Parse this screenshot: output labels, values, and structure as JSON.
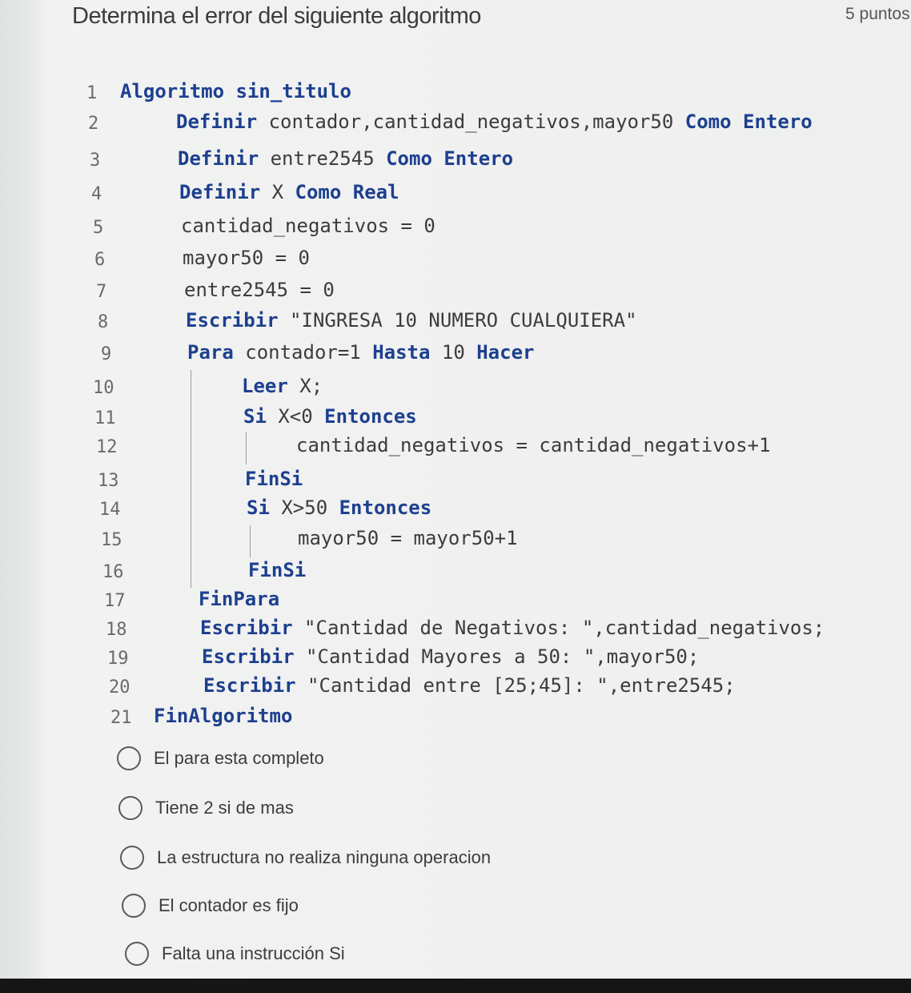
{
  "question": {
    "title": "Determina el error del siguiente algoritmo",
    "points": "5 puntos"
  },
  "code": [
    {
      "n": "1",
      "segs": [
        {
          "t": "Algoritmo",
          "kw": true
        },
        {
          "t": " sin_titulo",
          "kw": true
        }
      ]
    },
    {
      "n": "2",
      "segs": [
        {
          "t": "Definir",
          "kw": true
        },
        {
          "t": " contador,cantidad_negativos,mayor50 ",
          "kw": false
        },
        {
          "t": "Como Entero",
          "kw": true
        }
      ]
    },
    {
      "n": "3",
      "segs": [
        {
          "t": "Definir",
          "kw": true
        },
        {
          "t": " entre2545 ",
          "kw": false
        },
        {
          "t": "Como Entero",
          "kw": true
        }
      ]
    },
    {
      "n": "4",
      "segs": [
        {
          "t": "Definir",
          "kw": true
        },
        {
          "t": " X ",
          "kw": false
        },
        {
          "t": "Como Real",
          "kw": true
        }
      ]
    },
    {
      "n": "5",
      "segs": [
        {
          "t": "cantidad_negativos = 0",
          "kw": false
        }
      ]
    },
    {
      "n": "6",
      "segs": [
        {
          "t": "mayor50 = 0",
          "kw": false
        }
      ]
    },
    {
      "n": "7",
      "segs": [
        {
          "t": "entre2545 = 0",
          "kw": false
        }
      ]
    },
    {
      "n": "8",
      "segs": [
        {
          "t": "Escribir",
          "kw": true
        },
        {
          "t": " \"INGRESA 10 NUMERO CUALQUIERA\"",
          "kw": false
        }
      ]
    },
    {
      "n": "9",
      "segs": [
        {
          "t": "Para",
          "kw": true
        },
        {
          "t": " contador=1 ",
          "kw": false
        },
        {
          "t": "Hasta",
          "kw": true
        },
        {
          "t": " 10 ",
          "kw": false
        },
        {
          "t": "Hacer",
          "kw": true
        }
      ]
    },
    {
      "n": "10",
      "segs": [
        {
          "t": "Leer",
          "kw": true
        },
        {
          "t": " X;",
          "kw": false
        }
      ]
    },
    {
      "n": "11",
      "segs": [
        {
          "t": "Si",
          "kw": true
        },
        {
          "t": " X<0 ",
          "kw": false
        },
        {
          "t": "Entonces",
          "kw": true
        }
      ]
    },
    {
      "n": "12",
      "segs": [
        {
          "t": "cantidad_negativos = cantidad_negativos+1",
          "kw": false
        }
      ]
    },
    {
      "n": "13",
      "segs": [
        {
          "t": "FinSi",
          "kw": true
        }
      ]
    },
    {
      "n": "14",
      "segs": [
        {
          "t": "Si",
          "kw": true
        },
        {
          "t": " X>50 ",
          "kw": false
        },
        {
          "t": "Entonces",
          "kw": true
        }
      ]
    },
    {
      "n": "15",
      "segs": [
        {
          "t": "mayor50 = mayor50+1",
          "kw": false
        }
      ]
    },
    {
      "n": "16",
      "segs": [
        {
          "t": "FinSi",
          "kw": true
        }
      ]
    },
    {
      "n": "17",
      "segs": [
        {
          "t": "FinPara",
          "kw": true
        }
      ]
    },
    {
      "n": "18",
      "segs": [
        {
          "t": "Escribir",
          "kw": true
        },
        {
          "t": " \"Cantidad de Negativos: \",cantidad_negativos;",
          "kw": false
        }
      ]
    },
    {
      "n": "19",
      "segs": [
        {
          "t": "Escribir",
          "kw": true
        },
        {
          "t": " \"Cantidad Mayores a 50: \",mayor50;",
          "kw": false
        }
      ]
    },
    {
      "n": "20",
      "segs": [
        {
          "t": "Escribir",
          "kw": true
        },
        {
          "t": " \"Cantidad entre [25;45]: \",entre2545;",
          "kw": false
        }
      ]
    },
    {
      "n": "21",
      "segs": [
        {
          "t": "FinAlgoritmo",
          "kw": true
        }
      ]
    }
  ],
  "options": [
    {
      "label": "El para esta completo",
      "selected": false
    },
    {
      "label": "Tiene 2 si de mas",
      "selected": false
    },
    {
      "label": "La estructura no realiza ninguna operacion",
      "selected": false
    },
    {
      "label": "El contador es fijo",
      "selected": false
    },
    {
      "label": "Falta una instrucción Si",
      "selected": false
    }
  ]
}
